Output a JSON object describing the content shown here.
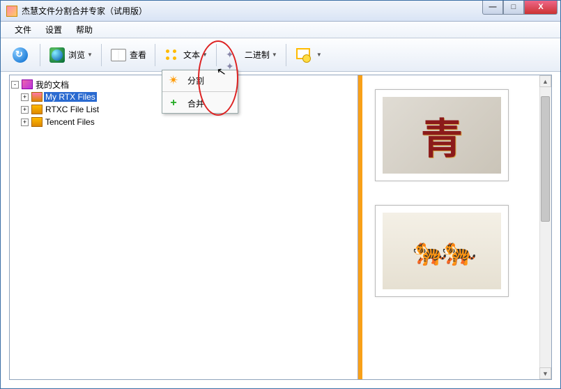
{
  "title": "杰慧文件分割合并专家（试用版）",
  "menu": {
    "file": "文件",
    "settings": "设置",
    "help": "帮助"
  },
  "toolbar": {
    "browse": "浏览",
    "view": "查看",
    "text": "文本",
    "binary": "二进制"
  },
  "dropdown": {
    "split": "分割",
    "merge": "合并"
  },
  "tree": {
    "root": "我的文档",
    "items": [
      {
        "label": "My RTX Files",
        "selected": true
      },
      {
        "label": "RTXC File List",
        "selected": false
      },
      {
        "label": "Tencent Files",
        "selected": false
      }
    ]
  },
  "winbtns": {
    "min": "—",
    "max": "□",
    "close": "X"
  },
  "colors": {
    "accent": "#f8a018",
    "selection": "#2a6ad0",
    "annotation": "#d22"
  }
}
